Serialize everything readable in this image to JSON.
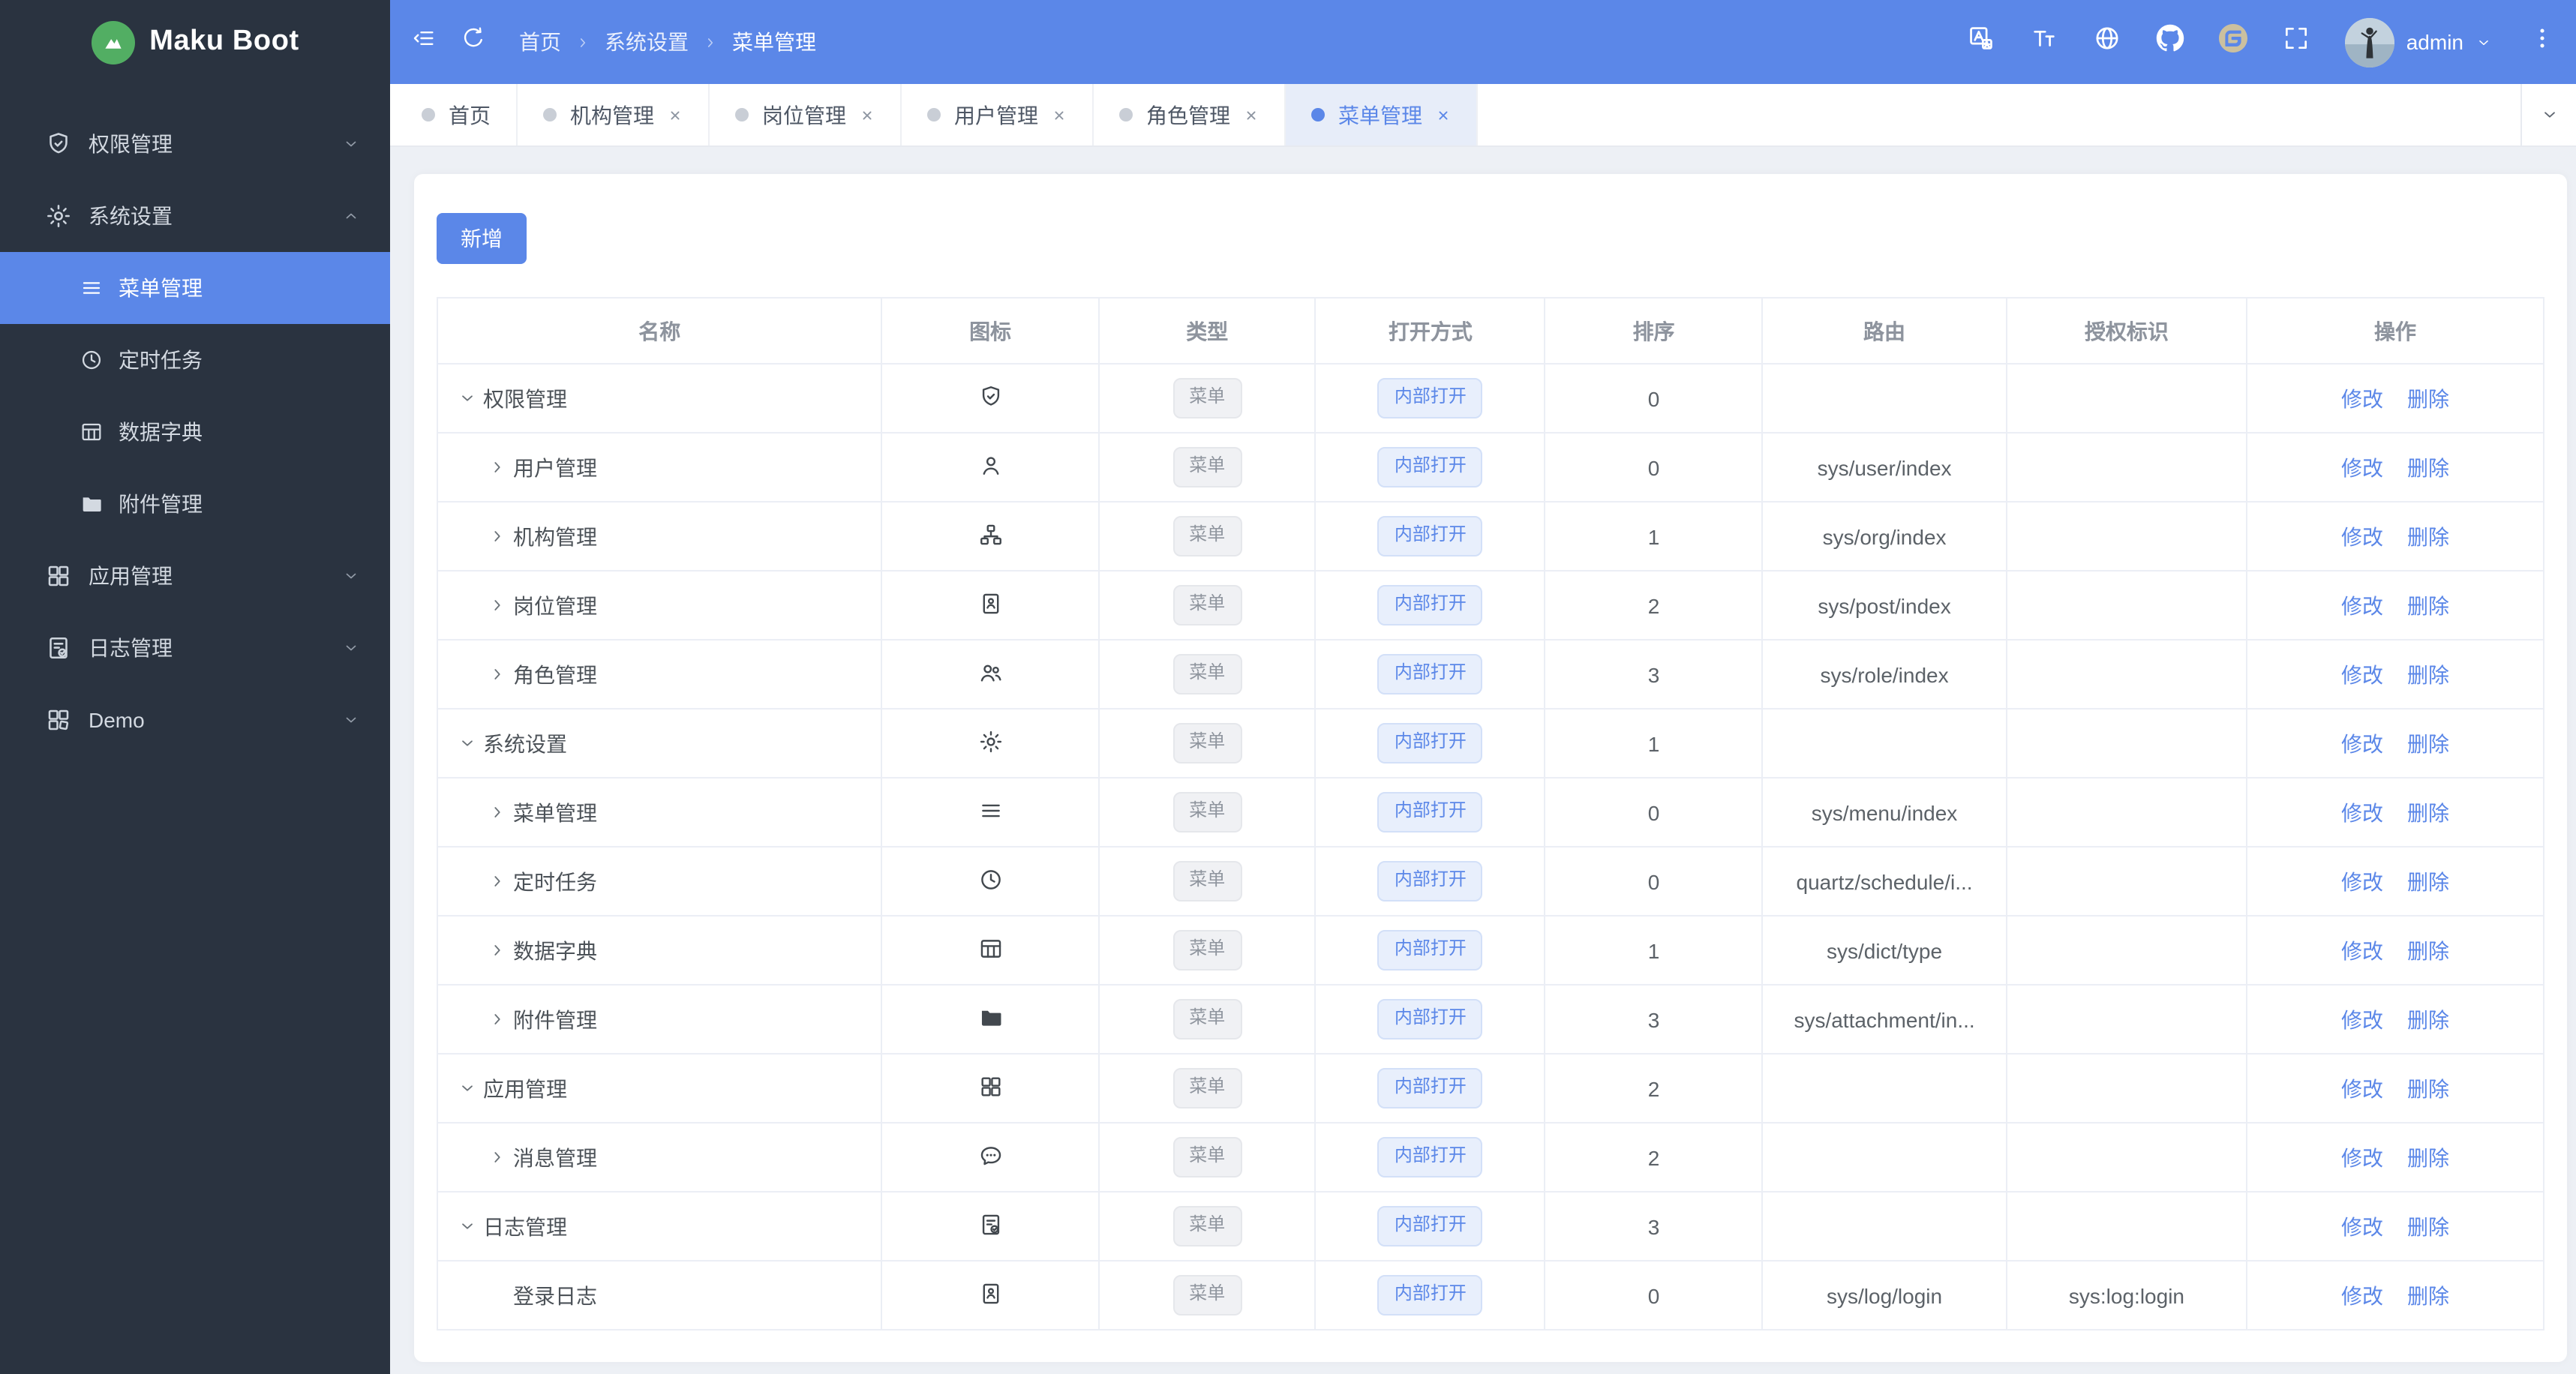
{
  "colors": {
    "primary": "#5b87e8",
    "sidebar_bg": "#2a3340",
    "content_bg": "#edf0f5",
    "logo_green": "#52ae63",
    "gitee": "#cbc09f",
    "tag_info_text": "#8f959e",
    "table_border": "#ebeef5"
  },
  "sidebar": {
    "logo_text": "Maku Boot",
    "logo_icon": "mountain-logo-icon",
    "items": [
      {
        "label": "权限管理",
        "icon": "shield-check-icon",
        "state": "collapsed"
      },
      {
        "label": "系统设置",
        "icon": "gear-icon",
        "state": "expanded",
        "children": [
          {
            "label": "菜单管理",
            "icon": "menu-icon",
            "active": true
          },
          {
            "label": "定时任务",
            "icon": "clock-icon",
            "active": false
          },
          {
            "label": "数据字典",
            "icon": "table-icon",
            "active": false
          },
          {
            "label": "附件管理",
            "icon": "folder-icon",
            "active": false
          }
        ]
      },
      {
        "label": "应用管理",
        "icon": "grid-icon",
        "state": "collapsed"
      },
      {
        "label": "日志管理",
        "icon": "log-icon",
        "state": "collapsed"
      },
      {
        "label": "Demo",
        "icon": "demo-grid-icon",
        "state": "collapsed"
      }
    ]
  },
  "header": {
    "fold_icon": "fold-icon",
    "refresh_icon": "refresh-icon",
    "breadcrumb": [
      "首页",
      "系统设置",
      "菜单管理"
    ],
    "tools": [
      "translate-icon",
      "font-size-icon",
      "globe-icon",
      "github-icon",
      "gitee-icon",
      "fullscreen-icon"
    ],
    "user_name": "admin",
    "user_menu_icon": "chevron-down-icon",
    "kebab_icon": "kebab-icon"
  },
  "tabbar": {
    "overflow_icon": "chevron-down-icon",
    "tabs": [
      {
        "label": "首页",
        "closable": false,
        "active": false
      },
      {
        "label": "机构管理",
        "closable": true,
        "active": false
      },
      {
        "label": "岗位管理",
        "closable": true,
        "active": false
      },
      {
        "label": "用户管理",
        "closable": true,
        "active": false
      },
      {
        "label": "角色管理",
        "closable": true,
        "active": false
      },
      {
        "label": "菜单管理",
        "closable": true,
        "active": true
      }
    ]
  },
  "main": {
    "add_button": "新增",
    "table": {
      "columns": [
        "名称",
        "图标",
        "类型",
        "打开方式",
        "排序",
        "路由",
        "授权标识",
        "操作"
      ],
      "actions": [
        "修改",
        "删除"
      ],
      "rows": [
        {
          "name": "权限管理",
          "level": 0,
          "expand": "expanded",
          "icon": "shield-check-icon",
          "type": "菜单",
          "open": "内部打开",
          "sort": "0",
          "route": "",
          "auth": ""
        },
        {
          "name": "用户管理",
          "level": 1,
          "expand": "collapsed",
          "icon": "user-icon",
          "type": "菜单",
          "open": "内部打开",
          "sort": "0",
          "route": "sys/user/index",
          "auth": ""
        },
        {
          "name": "机构管理",
          "level": 1,
          "expand": "collapsed",
          "icon": "org-icon",
          "type": "菜单",
          "open": "内部打开",
          "sort": "1",
          "route": "sys/org/index",
          "auth": ""
        },
        {
          "name": "岗位管理",
          "level": 1,
          "expand": "collapsed",
          "icon": "badge-icon",
          "type": "菜单",
          "open": "内部打开",
          "sort": "2",
          "route": "sys/post/index",
          "auth": ""
        },
        {
          "name": "角色管理",
          "level": 1,
          "expand": "collapsed",
          "icon": "users-icon",
          "type": "菜单",
          "open": "内部打开",
          "sort": "3",
          "route": "sys/role/index",
          "auth": ""
        },
        {
          "name": "系统设置",
          "level": 0,
          "expand": "expanded",
          "icon": "gear-icon",
          "type": "菜单",
          "open": "内部打开",
          "sort": "1",
          "route": "",
          "auth": ""
        },
        {
          "name": "菜单管理",
          "level": 1,
          "expand": "collapsed",
          "icon": "menu-icon",
          "type": "菜单",
          "open": "内部打开",
          "sort": "0",
          "route": "sys/menu/index",
          "auth": ""
        },
        {
          "name": "定时任务",
          "level": 1,
          "expand": "collapsed",
          "icon": "clock-icon",
          "type": "菜单",
          "open": "内部打开",
          "sort": "0",
          "route": "quartz/schedule/i...",
          "auth": ""
        },
        {
          "name": "数据字典",
          "level": 1,
          "expand": "collapsed",
          "icon": "table-icon",
          "type": "菜单",
          "open": "内部打开",
          "sort": "1",
          "route": "sys/dict/type",
          "auth": ""
        },
        {
          "name": "附件管理",
          "level": 1,
          "expand": "collapsed",
          "icon": "folder-icon",
          "type": "菜单",
          "open": "内部打开",
          "sort": "3",
          "route": "sys/attachment/in...",
          "auth": ""
        },
        {
          "name": "应用管理",
          "level": 0,
          "expand": "expanded",
          "icon": "grid-icon",
          "type": "菜单",
          "open": "内部打开",
          "sort": "2",
          "route": "",
          "auth": ""
        },
        {
          "name": "消息管理",
          "level": 1,
          "expand": "collapsed",
          "icon": "message-icon",
          "type": "菜单",
          "open": "内部打开",
          "sort": "2",
          "route": "",
          "auth": ""
        },
        {
          "name": "日志管理",
          "level": 0,
          "expand": "expanded",
          "icon": "log-icon",
          "type": "菜单",
          "open": "内部打开",
          "sort": "3",
          "route": "",
          "auth": ""
        },
        {
          "name": "登录日志",
          "level": 1,
          "expand": "leaf",
          "icon": "badge-icon",
          "type": "菜单",
          "open": "内部打开",
          "sort": "0",
          "route": "sys/log/login",
          "auth": "sys:log:login"
        }
      ]
    }
  }
}
